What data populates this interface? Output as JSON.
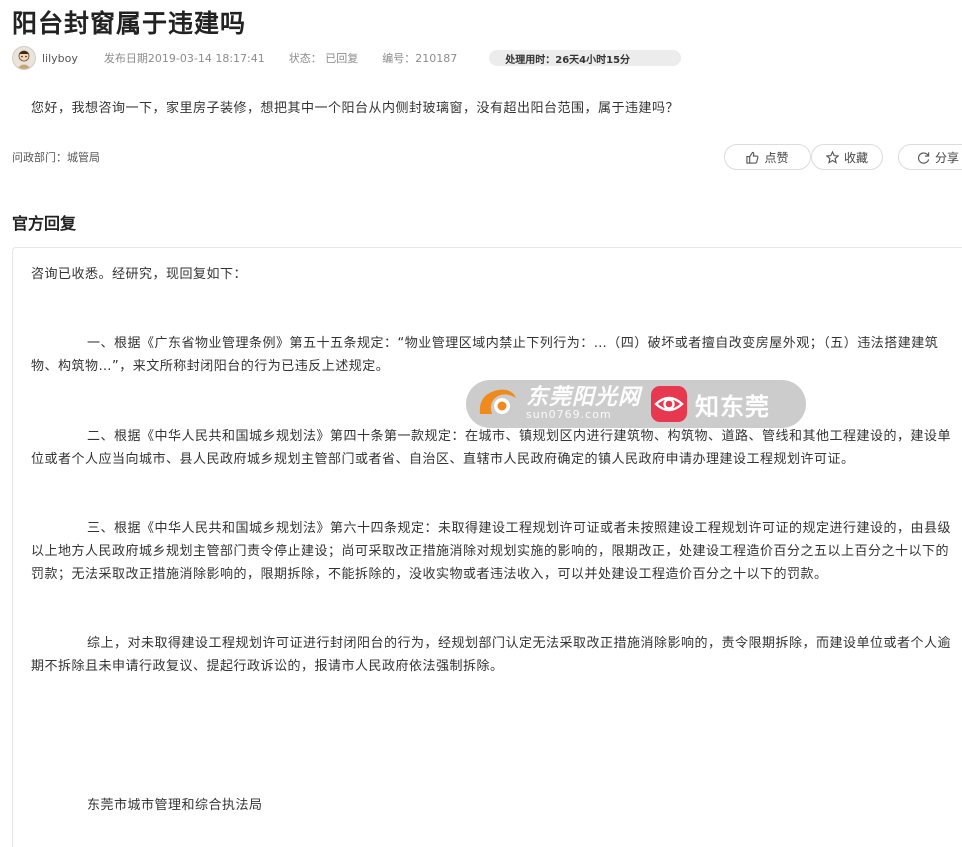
{
  "title": "阳台封窗属于违建吗",
  "meta": {
    "author": "lilyboy",
    "publish_date": "发布日期2019-03-14 18:17:41",
    "status": "状态： 已回复",
    "number": "编号：210187",
    "duration": "处理用时：26天4小时15分"
  },
  "question": "您好，我想咨询一下，家里房子装修，想把其中一个阳台从内侧封玻璃窗，没有超出阳台范围，属于违建吗？",
  "department": "问政部门：城管局",
  "actions": {
    "like": "点赞",
    "favorite": "收藏",
    "share": "分享"
  },
  "reply": {
    "heading": "官方回复",
    "intro": "咨询已收悉。经研究，现回复如下：",
    "paragraphs": [
      "一、根据《广东省物业管理条例》第五十五条规定：“物业管理区域内禁止下列行为：…（四）破坏或者擅自改变房屋外观；（五）违法搭建建筑物、构筑物…”，来文所称封闭阳台的行为已违反上述规定。",
      "二、根据《中华人民共和国城乡规划法》第四十条第一款规定：在城市、镇规划区内进行建筑物、构筑物、道路、管线和其他工程建设的，建设单位或者个人应当向城市、县人民政府城乡规划主管部门或者省、自治区、直辖市人民政府确定的镇人民政府申请办理建设工程规划许可证。",
      "三、根据《中华人民共和国城乡规划法》第六十四条规定：未取得建设工程规划许可证或者未按照建设工程规划许可证的规定进行建设的，由县级以上地方人民政府城乡规划主管部门责令停止建设；尚可采取改正措施消除对规划实施的影响的，限期改正，处建设工程造价百分之五以上百分之十以下的罚款；无法采取改正措施消除影响的，限期拆除，不能拆除的，没收实物或者违法收入，可以并处建设工程造价百分之十以下的罚款。",
      "综上，对未取得建设工程规划许可证进行封闭阳台的行为，经规划部门认定无法采取改正措施消除影响的，责令限期拆除，而建设单位或者个人逾期不拆除且未申请行政复议、提起行政诉讼的，报请市人民政府依法强制拆除。"
    ],
    "signature": "东莞市城市管理和综合执法局"
  },
  "watermark": {
    "site_name": "东莞阳光网",
    "site_domain": "sun0769.com",
    "brand": "知东莞"
  },
  "colors": {
    "watermark_orange": "#f08a1c",
    "watermark_red": "#e8384f"
  },
  "icons": {
    "like": "thumbs-up-icon",
    "favorite": "star-icon",
    "share": "share-icon"
  }
}
